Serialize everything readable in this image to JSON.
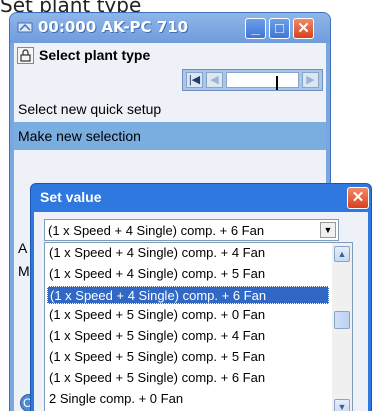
{
  "caption": "Set plant type",
  "window": {
    "title": "00:000 AK-PC 710",
    "heading": "Select plant type",
    "buttons": {
      "minimize": "_",
      "maximize": "□",
      "close": "✕"
    },
    "nav": {
      "first": "|◀",
      "prev": "◀",
      "next": "▶"
    },
    "menu": [
      "Select new quick setup",
      "Make new selection"
    ],
    "partial": [
      "A",
      "M"
    ],
    "footer_button": "O"
  },
  "dialog": {
    "title": "Set value",
    "close": "✕",
    "selected_value": "(1 x Speed + 4 Single) comp. + 6 Fan",
    "dropdown_arrow": "▼",
    "options": [
      "(1 x Speed + 4 Single) comp. + 4 Fan",
      "(1 x Speed + 4 Single) comp. + 5 Fan",
      "(1 x Speed + 4 Single) comp. + 6 Fan",
      "(1 x Speed + 5 Single) comp. + 0 Fan",
      "(1 x Speed + 5 Single) comp. + 4 Fan",
      "(1 x Speed + 5 Single) comp. + 5 Fan",
      "(1 x Speed + 5 Single) comp. + 6 Fan",
      "2 Single comp. + 0 Fan"
    ],
    "selected_index": 2,
    "scroll": {
      "up": "▲",
      "down": "▼"
    }
  }
}
